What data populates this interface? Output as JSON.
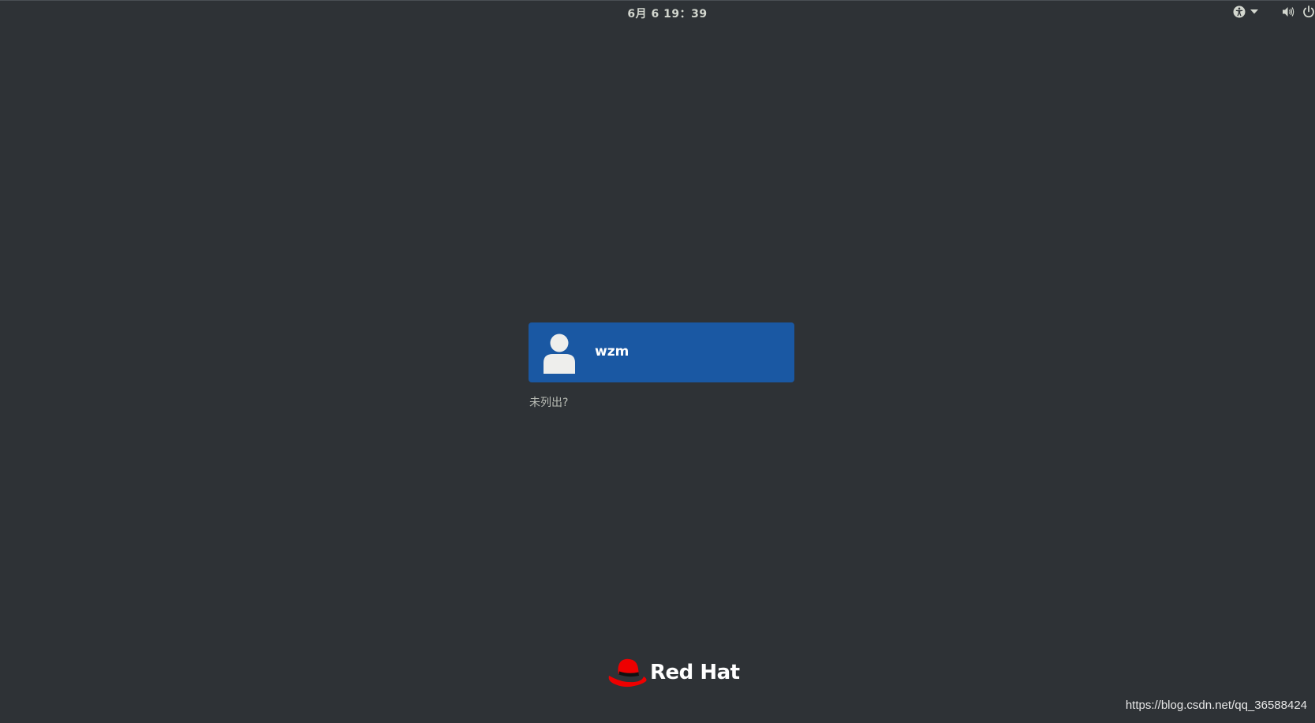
{
  "topbar": {
    "clock": "6月 6  19：39",
    "icons": [
      "accessibility-icon",
      "dropdown-arrow-icon",
      "volume-icon",
      "power-icon"
    ]
  },
  "login": {
    "user": {
      "name": "wzm",
      "avatar_icon": "user-avatar-icon"
    },
    "not_listed_label": "未列出?"
  },
  "branding": {
    "logo_text": "Red Hat",
    "logo_icon": "red-hat-fedora-icon"
  },
  "watermark": "https://blog.csdn.net/qq_36588424",
  "colors": {
    "background": "#2e3236",
    "user_card": "#1a58a3",
    "brand_red": "#ee0000"
  }
}
